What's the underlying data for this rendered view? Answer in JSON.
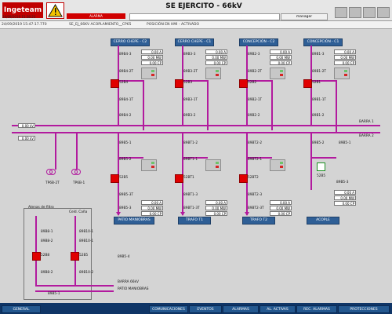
{
  "header": {
    "brand": "Ingeteam",
    "datetime": "24/09/2019 15:58:23",
    "alarm_label": "ALARMA",
    "title": "SE EJERCITO - 66kV",
    "user": "manager"
  },
  "subheader": {
    "event_time": "24/09/2019 15:47:17.770",
    "event_text": "SE_EJ_66KV ACOPLAMIENTO__CP65",
    "event_status": "POSICIÓN EN HMI - ACTIVADO"
  },
  "feeders": [
    {
      "label": "CERRO CHEPE - C2"
    },
    {
      "label": "CERRO CHEPE - C1"
    },
    {
      "label": "CONCEPCIÓN - C2"
    },
    {
      "label": "CONCEPCIÓN - C1"
    }
  ],
  "bays": [
    {
      "labels": [
        "89B4-3",
        "89B4-2T",
        "52B4",
        "89B4-1T",
        "89B4-2",
        "89B5-1",
        "89B5-2",
        "52B5",
        "89B5-3T",
        "89B5-3"
      ]
    },
    {
      "labels": [
        "89B3-3",
        "89B3-2T",
        "52B3",
        "89B3-1T",
        "89B3-2",
        "89BT1-2",
        "89BT1-1",
        "52BT1",
        "89BT1-3",
        "89BT1-3T"
      ]
    },
    {
      "labels": [
        "89B2-3",
        "89B2-2T",
        "52B2",
        "89B2-1T",
        "89B2-2",
        "89BT2-2",
        "89BT2-1",
        "52BT2",
        "89BT2-3",
        "89BT2-3T"
      ]
    },
    {
      "labels": [
        "89B1-3",
        "89B1-2T",
        "52B1",
        "89B1-1T",
        "89B1-2",
        "89B5-2",
        "89B5-1",
        "52B5",
        "89B5-3"
      ]
    }
  ],
  "readouts": {
    "top": [
      [
        "0.00 A",
        "0.00 MW",
        "0.00 CP"
      ],
      [
        "0.00 A",
        "0.00 MW",
        "0.00 CP"
      ],
      [
        "0.00 A",
        "0.00 MW",
        "0.00 CP"
      ],
      [
        "0.00 A",
        "0.00 MW",
        "0.00 CP"
      ]
    ],
    "bottom": [
      [
        "0.00 A",
        "0.00 MW",
        "0.00 CP"
      ],
      [
        "0.00 A",
        "0.00 MW",
        "0.00 CP"
      ],
      [
        "0.00 A",
        "0.00 MW",
        "0.00 CP"
      ],
      [
        "0.00 A",
        "0.00 MW",
        "0.00 CP"
      ]
    ]
  },
  "left_panel": {
    "bus_a": "0.00 kV",
    "bus_b": "0.00 kV",
    "tp_labels": [
      "TP6B-2T",
      "TP6B-1"
    ]
  },
  "bus": {
    "barra1": "BARRA 1",
    "barra2": "BARRA 2"
  },
  "bottom_labels": {
    "patio_maniobras": "PATIO MANIOBRAS",
    "trafo_t1": "TRAFO T1",
    "trafo_t2": "TRAFO T2",
    "acople": "ACOPLE"
  },
  "small_area": {
    "title": "Atenas de filtro",
    "subtitle": "Celd. Caña",
    "labels": [
      "89B8-1",
      "89B8-2",
      "52B8",
      "89B8-2",
      "89B10-1",
      "89B10-1",
      "52B5",
      "89B10-2",
      "89B5-4",
      "89B5-1",
      "BARRA 66kV",
      "PATIO MANIOBRAS"
    ]
  },
  "bottom_nav": [
    "GENERAL",
    "COMUNICACIONES",
    "EVENTOS",
    "ALARMAS",
    "AL. ACTIVAS",
    "REC. ALARMAS",
    "PROTECCIONES"
  ],
  "colors": {
    "bus": "#b21a9e",
    "feeder_bar": "#2f5f96",
    "open_breaker": "#e00000",
    "closed_breaker": "#1a8f21"
  }
}
